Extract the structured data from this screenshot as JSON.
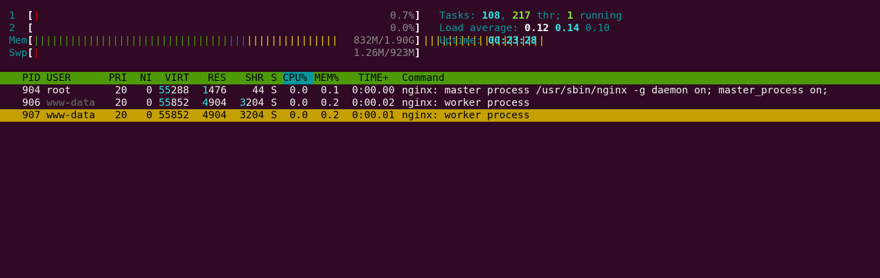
{
  "meters": {
    "cpu1": {
      "label": "1",
      "bar": "|",
      "value": "0.7%"
    },
    "cpu2": {
      "label": "2",
      "bar": "",
      "value": "0.0%"
    },
    "mem": {
      "label": "Mem",
      "bar_green": "||||||||||||||||||||||||||||||||",
      "bar_blue": "|||",
      "bar_yellow": "|||||||||||||||||||||||||||||||||||||||||||||||||",
      "value": "832M/1.90G"
    },
    "swp": {
      "label": "Swp",
      "bar": "|",
      "value": "1.26M/923M"
    }
  },
  "summary": {
    "tasks_label": "Tasks: ",
    "tasks": "108",
    "thr": "217",
    "thr_label": " thr; ",
    "running": "1",
    "running_label": " running",
    "load_label": "Load average: ",
    "load1": "0.12",
    "load5": "0.14",
    "load15": "0.10",
    "uptime_label": "Uptime: ",
    "uptime": "00:23:28"
  },
  "columns": {
    "pid": "PID",
    "user": "USER",
    "pri": "PRI",
    "ni": "NI",
    "virt": "VIRT",
    "res": "RES",
    "shr": "SHR",
    "s": "S",
    "cpu": "CPU%",
    "mem": "MEM%",
    "time": "TIME+",
    "command": "Command"
  },
  "processes": [
    {
      "pid": "904",
      "user": "root",
      "pri": "20",
      "ni": "0",
      "virt_hi": "55",
      "virt_lo": "288",
      "res_hi": "1",
      "res_lo": "476",
      "shr_hi": "",
      "shr_lo": "44",
      "s": "S",
      "cpu": "0.0",
      "mem": "0.1",
      "time": "0:00.00",
      "command": "nginx: master process /usr/sbin/nginx -g daemon on; master_process on;"
    },
    {
      "pid": "906",
      "user": "www-data",
      "pri": "20",
      "ni": "0",
      "virt_hi": "55",
      "virt_lo": "852",
      "res_hi": "4",
      "res_lo": "904",
      "shr_hi": "3",
      "shr_lo": "204",
      "s": "S",
      "cpu": "0.0",
      "mem": "0.2",
      "time": "0:00.02",
      "command": "nginx: worker process"
    },
    {
      "pid": "907",
      "user": "www-data",
      "pri": "20",
      "ni": "0",
      "virt_hi": "55",
      "virt_lo": "852",
      "res_hi": "4",
      "res_lo": "904",
      "shr_hi": "3",
      "shr_lo": "204",
      "s": "S",
      "cpu": "0.0",
      "mem": "0.2",
      "time": "0:00.01",
      "command": "nginx: worker process"
    }
  ]
}
